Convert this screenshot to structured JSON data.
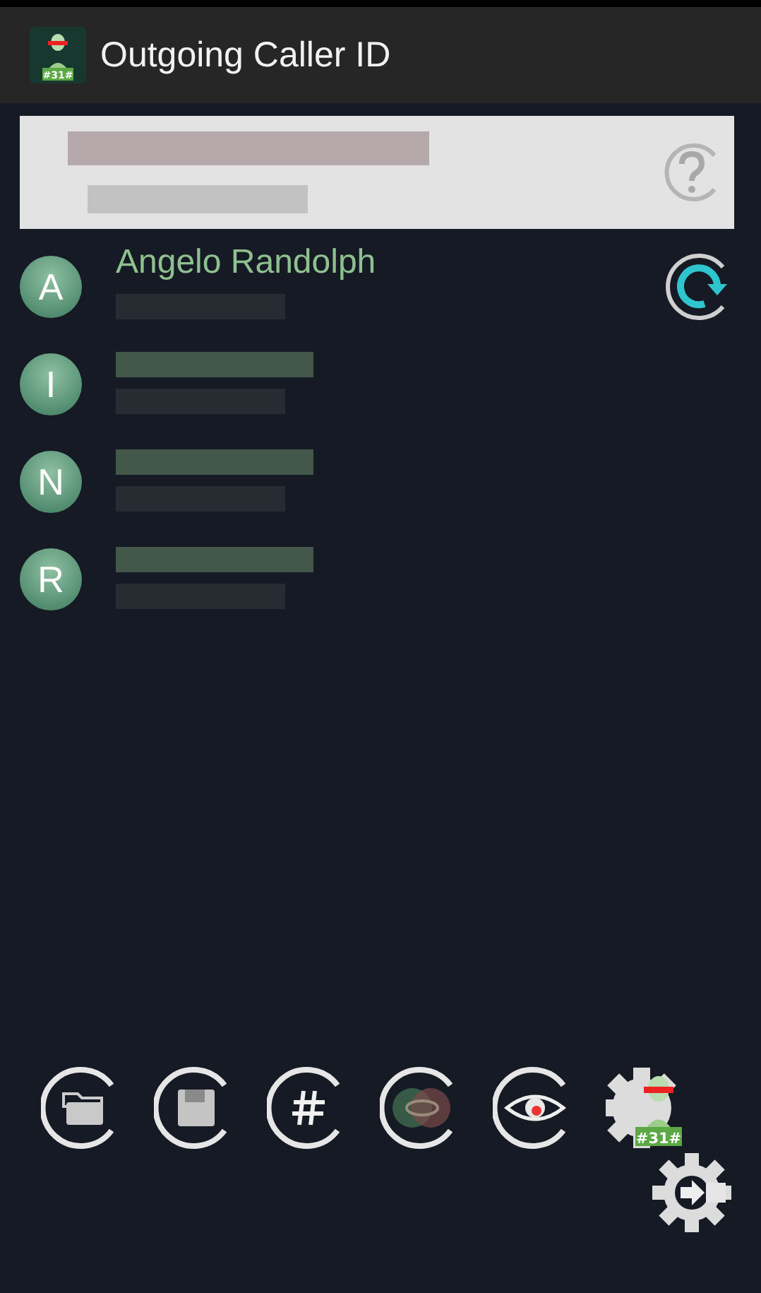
{
  "app_bar": {
    "title": "Outgoing Caller ID",
    "badge": "#31#"
  },
  "contacts": [
    {
      "initial": "A",
      "name": "Angelo Randolph"
    },
    {
      "initial": "I"
    },
    {
      "initial": "N"
    },
    {
      "initial": "R"
    }
  ],
  "toolbar": {
    "badge": "#31#"
  }
}
